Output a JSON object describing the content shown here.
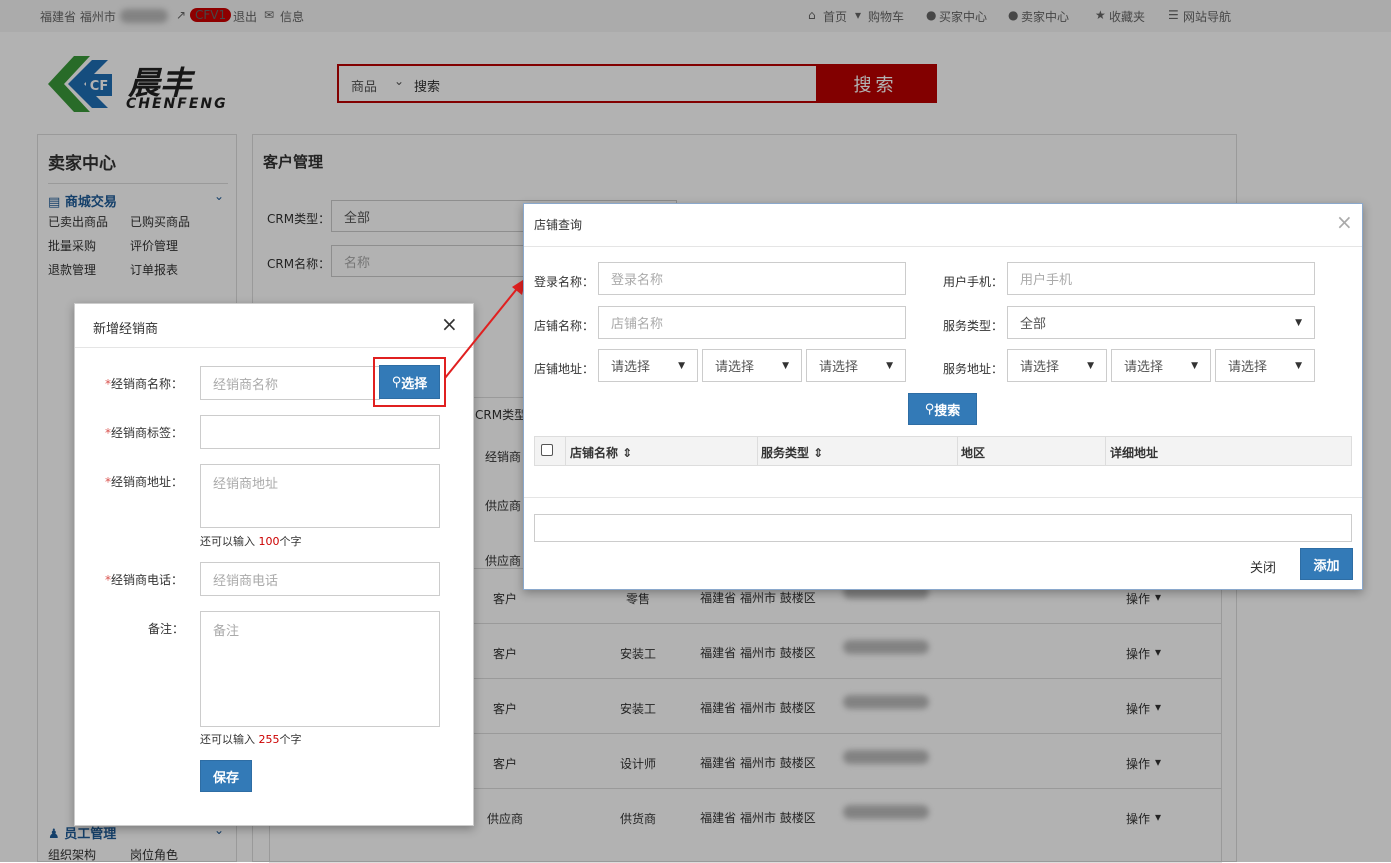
{
  "topbar": {
    "location": "福建省 福州市",
    "badge": "CFV1",
    "logout": "退出",
    "messages": "信息",
    "home": "首页",
    "cart": "购物车",
    "buyer_center": "买家中心",
    "seller_center": "卖家中心",
    "favorites": "收藏夹",
    "site_nav": "网站导航"
  },
  "logo": {
    "name": "晨丰",
    "latin": "CHENFENG"
  },
  "search": {
    "category": "商品",
    "placeholder": "搜索",
    "button": "搜索"
  },
  "sidebar": {
    "title": "卖家中心",
    "section1": "商城交易",
    "items1": [
      "已卖出商品",
      "已购买商品",
      "批量采购",
      "评价管理",
      "退款管理",
      "订单报表"
    ],
    "section_last": "员工管理",
    "items_last": [
      "组织架构",
      "岗位角色"
    ]
  },
  "main": {
    "title": "客户管理",
    "crm_type_label": "CRM类型：",
    "crm_type_value": "全部",
    "crm_name_label": "CRM名称：",
    "crm_name_placeholder": "名称",
    "col_crm_type": "CRM类型",
    "rows": [
      {
        "type": "客户",
        "role": "零售",
        "region": "福建省 福州市 鼓楼区",
        "action": "操作"
      },
      {
        "type": "客户",
        "role": "安装工",
        "region": "福建省 福州市 鼓楼区",
        "action": "操作"
      },
      {
        "type": "客户",
        "role": "安装工",
        "region": "福建省 福州市 鼓楼区",
        "action": "操作"
      },
      {
        "type": "客户",
        "role": "设计师",
        "region": "福建省 福州市 鼓楼区",
        "action": "操作"
      },
      {
        "type": "供应商",
        "role": "供货商",
        "region": "福建省 福州市 鼓楼区",
        "action": "操作"
      }
    ],
    "partial_rows": [
      "经销商",
      "供应商",
      "供应商"
    ]
  },
  "dealer_modal": {
    "title": "新增经销商",
    "name_label": "经销商名称：",
    "name_placeholder": "经销商名称",
    "select_button": "选择",
    "tag_label": "经销商标签：",
    "address_label": "经销商地址：",
    "address_placeholder": "经销商地址",
    "address_hint_pre": "还可以输入",
    "address_hint_num": "100",
    "address_hint_post": "个字",
    "phone_label": "经销商电话：",
    "phone_placeholder": "经销商电话",
    "remark_label": "备注：",
    "remark_placeholder": "备注",
    "remark_hint_num": "255",
    "save_button": "保存"
  },
  "store_modal": {
    "title": "店铺查询",
    "login_label": "登录名称：",
    "login_placeholder": "登录名称",
    "phone_label": "用户手机：",
    "phone_placeholder": "用户手机",
    "store_label": "店铺名称：",
    "store_placeholder": "店铺名称",
    "service_type_label": "服务类型：",
    "service_type_value": "全部",
    "store_addr_label": "店铺地址：",
    "service_addr_label": "服务地址：",
    "select_placeholder": "请选择",
    "search_button": "搜索",
    "columns": [
      "店铺名称",
      "服务类型",
      "地区",
      "详细地址"
    ],
    "close_button": "关闭",
    "add_button": "添加"
  },
  "colors": {
    "accent_red": "#c00",
    "primary_blue": "#337ab7",
    "highlight": "#e02020"
  }
}
